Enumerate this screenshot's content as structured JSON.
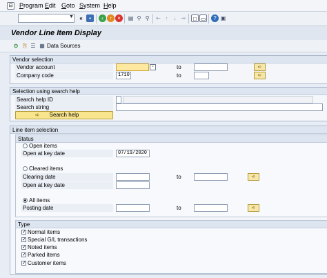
{
  "menu": {
    "items": [
      {
        "label": "Program",
        "hot": "P"
      },
      {
        "label": "Edit",
        "hot": "E"
      },
      {
        "label": "Goto",
        "hot": "G"
      },
      {
        "label": "System",
        "hot": "S"
      },
      {
        "label": "Help",
        "hot": "H"
      }
    ]
  },
  "toolbar": {
    "command_value": "",
    "back_glyph": "«"
  },
  "title": "Vendor Line Item Display",
  "app_toolbar": {
    "data_sources_label": "Data Sources"
  },
  "vendor_selection": {
    "title": "Vendor selection",
    "vendor_account_label": "Vendor account",
    "vendor_account_value": "",
    "company_code_label": "Company code",
    "company_code_value": "1710",
    "to_label": "to"
  },
  "search_help": {
    "title": "Selection using search help",
    "search_help_id_label": "Search help ID",
    "search_string_label": "Search string",
    "search_help_button": "Search help"
  },
  "line_item_selection": {
    "title": "Line item selection",
    "status_title": "Status",
    "open_items_label": "Open items",
    "open_at_key_date_label": "Open at key date",
    "open_at_key_date_value": "07/19/2020",
    "cleared_items_label": "Cleared items",
    "clearing_date_label": "Clearing date",
    "cleared_open_at_key_date_label": "Open at key date",
    "all_items_label": "All items",
    "posting_date_label": "Posting date",
    "to_label": "to",
    "selected_status": "All items"
  },
  "type": {
    "title": "Type",
    "items": [
      {
        "label": "Normal items",
        "checked": true
      },
      {
        "label": "Special G/L transactions",
        "checked": true
      },
      {
        "label": "Noted items",
        "checked": true
      },
      {
        "label": "Parked items",
        "checked": true
      },
      {
        "label": "Customer items",
        "checked": true
      }
    ]
  },
  "colors": {
    "required_field": "#ffe8a0",
    "background": "#e8edf5",
    "button_yellow": "#f8e58e"
  }
}
